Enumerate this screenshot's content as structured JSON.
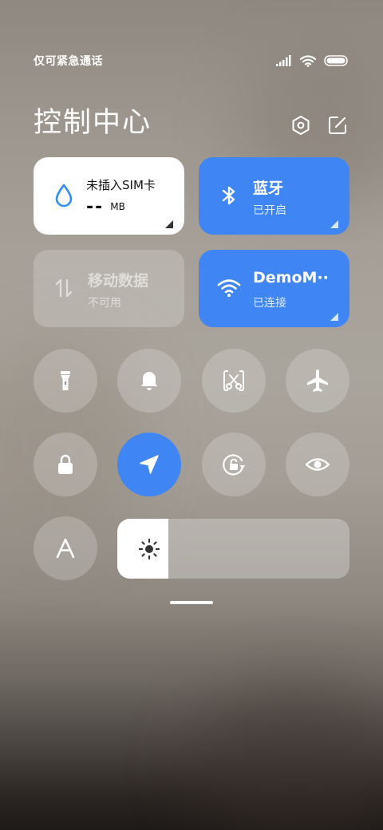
{
  "status_bar": {
    "carrier_text": "仅可紧急通话",
    "icons": [
      "signal-icon",
      "wifi-icon",
      "battery-icon"
    ]
  },
  "header": {
    "title": "控制中心",
    "actions": [
      "settings-icon",
      "edit-icon"
    ]
  },
  "tiles": {
    "sim": {
      "title": "未插入SIM卡",
      "value": "--",
      "unit": "MB",
      "icon": "water-drop-icon"
    },
    "bluetooth": {
      "title": "蓝牙",
      "status": "已开启",
      "icon": "bluetooth-icon"
    },
    "mobile_data": {
      "title": "移动数据",
      "status": "不可用",
      "icon": "data-arrows-icon"
    },
    "wifi": {
      "title": "DemoM··",
      "status": "已连接",
      "icon": "wifi-icon"
    }
  },
  "toggles": [
    {
      "name": "flashlight",
      "icon": "flashlight-icon",
      "active": false
    },
    {
      "name": "ringer",
      "icon": "bell-icon",
      "active": false
    },
    {
      "name": "screenshot",
      "icon": "scissors-icon",
      "active": false
    },
    {
      "name": "airplane-mode",
      "icon": "airplane-icon",
      "active": false
    },
    {
      "name": "lock-screen",
      "icon": "lock-icon",
      "active": false
    },
    {
      "name": "location",
      "icon": "location-arrow-icon",
      "active": true
    },
    {
      "name": "auto-rotate",
      "icon": "rotate-lock-icon",
      "active": false
    },
    {
      "name": "reading-mode",
      "icon": "eye-icon",
      "active": false
    },
    {
      "name": "font-size",
      "icon": "font-a-icon",
      "active": false
    }
  ],
  "brightness": {
    "level": 0.22,
    "icon": "sun-icon"
  },
  "colors": {
    "accent_blue": "#3f86f4",
    "tile_white": "#ffffff",
    "water_drop": "#2f8ff0"
  }
}
